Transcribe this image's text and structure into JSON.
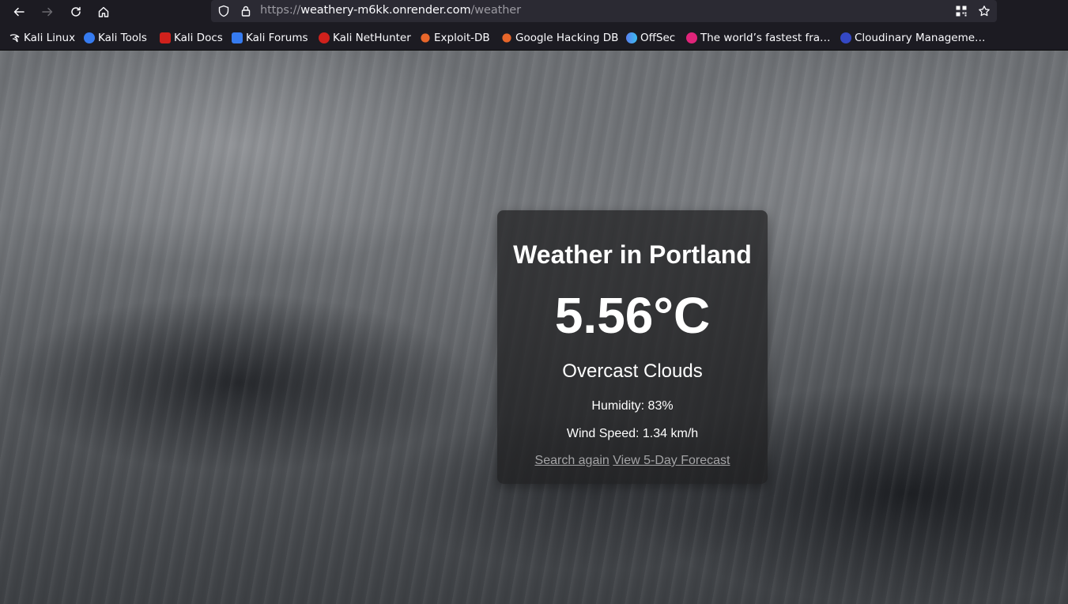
{
  "browser": {
    "url_scheme": "https://",
    "url_host": "weathery-m6kk.onrender.com",
    "url_path": "/weather",
    "bookmarks": [
      {
        "label": "Kali Linux",
        "color": "#2b2a33"
      },
      {
        "label": "Kali Tools",
        "color": "#367bf0"
      },
      {
        "label": "Kali Docs",
        "color": "#d0211c"
      },
      {
        "label": "Kali Forums",
        "color": "#367bf0"
      },
      {
        "label": "Kali NetHunter",
        "color": "#d0211c"
      },
      {
        "label": "Exploit-DB",
        "color": "#e8662a"
      },
      {
        "label": "Google Hacking DB",
        "color": "#e8662a"
      },
      {
        "label": "OffSec",
        "color": "#5a7ff0"
      },
      {
        "label": "The world’s fastest fra…",
        "color": "#e0247a"
      },
      {
        "label": "Cloudinary Manageme…",
        "color": "#3448c5"
      }
    ]
  },
  "weather": {
    "title": "Weather in Portland",
    "temperature": "5.56°C",
    "description": "Overcast Clouds",
    "humidity": "Humidity: 83%",
    "wind": "Wind Speed: 1.34 km/h",
    "search_again": "Search again",
    "forecast_link": "View 5-Day Forecast"
  }
}
